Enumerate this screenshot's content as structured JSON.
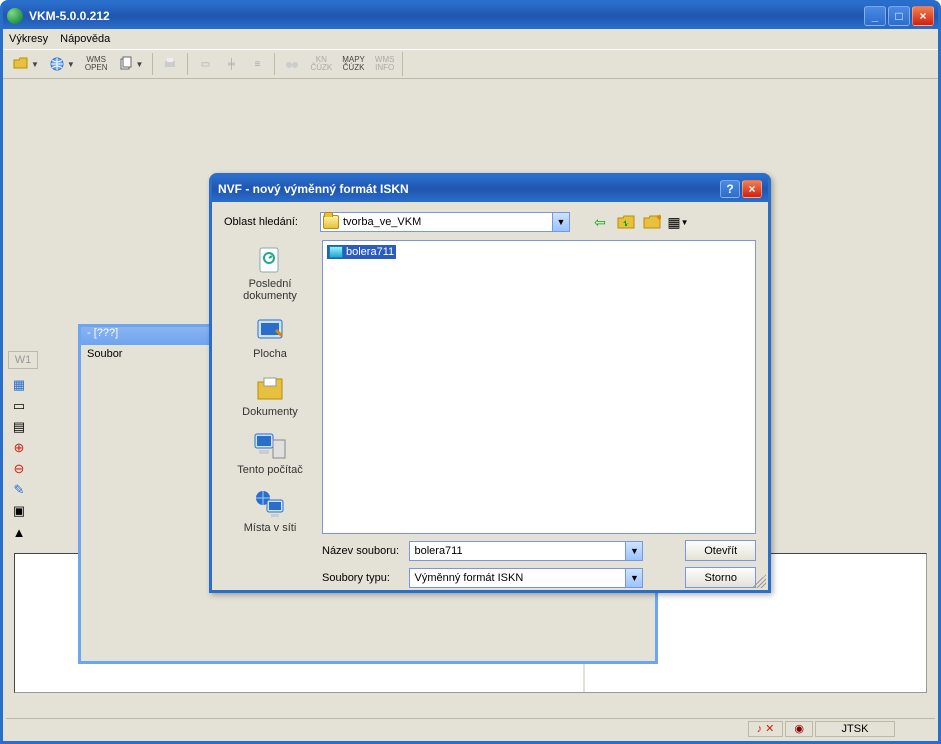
{
  "app": {
    "title": "VKM-5.0.0.212"
  },
  "menu": {
    "items": [
      "Výkresy",
      "Nápověda"
    ]
  },
  "toolbar": {
    "wms_open": "WMS\nOPEN",
    "kn_cuzk": "KN\nČÚZK",
    "mapy_cuzk": "MAPY\nČÚZK",
    "wms_info": "WMS\nINFO"
  },
  "side_tab": "W1",
  "sub_window": {
    "title": " - [???]",
    "menu_item": "Soubor"
  },
  "dialog": {
    "title": "NVF - nový výměnný formát ISKN",
    "look_in_label": "Oblast hledání:",
    "look_in_value": "tvorba_ve_VKM",
    "places": {
      "recent": "Poslední\ndokumenty",
      "desktop": "Plocha",
      "documents": "Dokumenty",
      "computer": "Tento počítač",
      "network": "Místa v síti"
    },
    "file_item": "bolera711",
    "filename_label": "Název souboru:",
    "filename_value": "bolera711",
    "filetype_label": "Soubory typu:",
    "filetype_value": "Výměnný formát ISKN",
    "open_btn": "Otevřít",
    "cancel_btn": "Storno"
  },
  "status": {
    "coords": "JTSK"
  }
}
